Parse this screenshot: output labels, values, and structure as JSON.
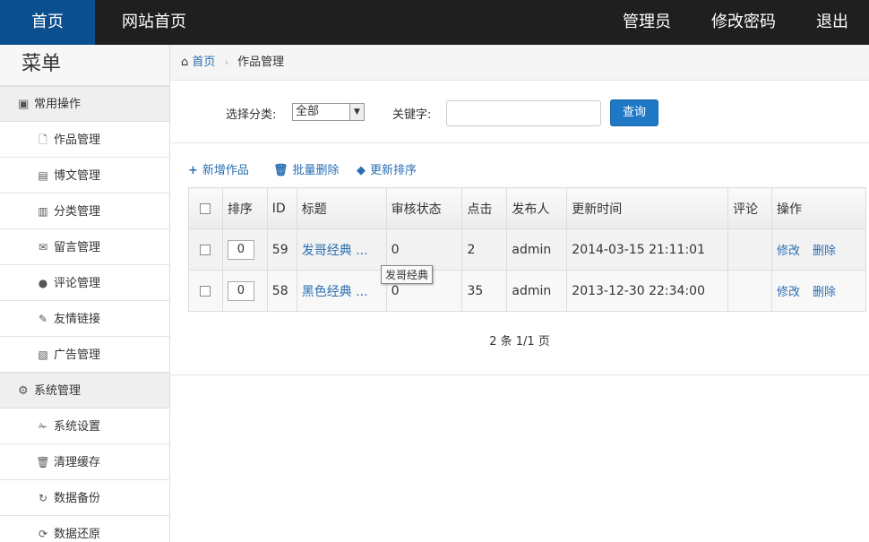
{
  "topnav": {
    "home": "首页",
    "site_home": "网站首页",
    "admin": "管理员",
    "change_password": "修改密码",
    "logout": "退出"
  },
  "sidebar": {
    "title": "菜单",
    "groups": [
      {
        "label": "常用操作",
        "items": [
          {
            "label": "作品管理",
            "icon": "file-icon"
          },
          {
            "label": "博文管理",
            "icon": "list-icon"
          },
          {
            "label": "分类管理",
            "icon": "books-icon"
          },
          {
            "label": "留言管理",
            "icon": "envelope-icon"
          },
          {
            "label": "评论管理",
            "icon": "comment-icon"
          },
          {
            "label": "友情链接",
            "icon": "link-icon"
          },
          {
            "label": "广告管理",
            "icon": "picture-icon"
          }
        ]
      },
      {
        "label": "系统管理",
        "items": [
          {
            "label": "系统设置",
            "icon": "wrench-icon"
          },
          {
            "label": "清理缓存",
            "icon": "trash-icon"
          },
          {
            "label": "数据备份",
            "icon": "refresh-icon"
          },
          {
            "label": "数据还原",
            "icon": "restore-icon"
          }
        ]
      }
    ]
  },
  "breadcrumb": {
    "home": "首页",
    "current": "作品管理"
  },
  "search": {
    "category_label": "选择分类:",
    "category_value": "全部",
    "keyword_label": "关键字:",
    "keyword_value": "",
    "query_button": "查询"
  },
  "toolbar": {
    "add": "新增作品",
    "batch_delete": "批量删除",
    "update_sort": "更新排序"
  },
  "table": {
    "headers": [
      "排序",
      "ID",
      "标题",
      "审核状态",
      "点击",
      "发布人",
      "更新时间",
      "评论",
      "操作"
    ],
    "rows": [
      {
        "sort": "0",
        "id": "59",
        "title": "发哥经典 ...",
        "status": "0",
        "clicks": "2",
        "author": "admin",
        "updated": "2014-03-15 21:11:01",
        "comments": "",
        "edit": "修改",
        "delete": "删除"
      },
      {
        "sort": "0",
        "id": "58",
        "title": "黑色经典 ...",
        "status": "0",
        "clicks": "35",
        "author": "admin",
        "updated": "2013-12-30 22:34:00",
        "comments": "",
        "edit": "修改",
        "delete": "删除"
      }
    ]
  },
  "tooltip": "发哥经典",
  "pager": "2 条 1/1 页",
  "colors": {
    "topbar": "#1f1f1f",
    "active_nav": "#0b4f8f",
    "link": "#2a6fb3",
    "button": "#1f78c6"
  }
}
